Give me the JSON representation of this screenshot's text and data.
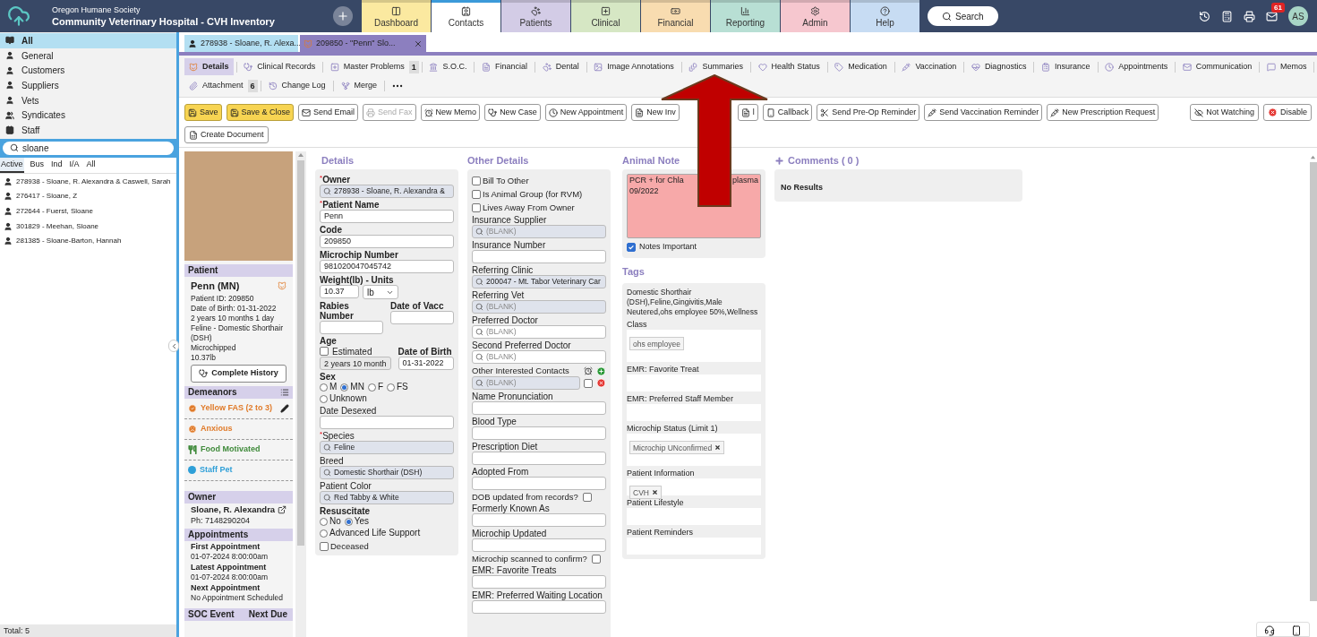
{
  "app": {
    "org": "Oregon Humane Society",
    "title": "Community Veterinary Hospital - CVH Inventory"
  },
  "nav_tabs": [
    {
      "label": "Dashboard",
      "color": "#fbe9a0",
      "selected": false
    },
    {
      "label": "Contacts",
      "color": "#ffffff",
      "selected": true
    },
    {
      "label": "Patients",
      "color": "#d3cce6",
      "selected": false
    },
    {
      "label": "Clinical",
      "color": "#d6e7c4",
      "selected": false
    },
    {
      "label": "Financial",
      "color": "#f8dcb0",
      "selected": false
    },
    {
      "label": "Reporting",
      "color": "#b8dfd4",
      "selected": false
    },
    {
      "label": "Admin",
      "color": "#f6c7cf",
      "selected": false
    },
    {
      "label": "Help",
      "color": "#c7dcf3",
      "selected": false
    }
  ],
  "search_button": "Search",
  "notification_count": "61",
  "avatar": "AS",
  "sidebar": {
    "categories": [
      {
        "label": "All",
        "selected": true
      },
      {
        "label": "General",
        "selected": false
      },
      {
        "label": "Customers",
        "selected": false
      },
      {
        "label": "Suppliers",
        "selected": false
      },
      {
        "label": "Vets",
        "selected": false
      },
      {
        "label": "Syndicates",
        "selected": false
      },
      {
        "label": "Staff",
        "selected": false
      }
    ],
    "search": {
      "value": "sloane"
    },
    "filters": [
      {
        "label": "Active",
        "selected": true
      },
      {
        "label": "Bus",
        "selected": false
      },
      {
        "label": "Ind",
        "selected": false
      },
      {
        "label": "I/A",
        "selected": false
      },
      {
        "label": "All",
        "selected": false
      }
    ],
    "results": [
      "278938 - Sloane, R. Alexandra & Caswell, Sarah",
      "276417 - Sloane, Z",
      "272644 - Fuerst, Sloane",
      "301829 - Meehan, Sloane",
      "281385 - Sloane-Barton, Hannah"
    ],
    "total": "Total: 5"
  },
  "record_tabs": [
    {
      "label": "278938 - Sloane, R. Alexa...",
      "selected": false,
      "closable": false
    },
    {
      "label": "209850 - \"Penn\" Slo...",
      "selected": true,
      "closable": true
    }
  ],
  "subtabs": [
    [
      {
        "label": "Details",
        "selected": true
      },
      {
        "label": "Clinical Records",
        "selected": false
      },
      {
        "label": "Master Problems",
        "selected": false,
        "count": "1"
      },
      {
        "label": "S.O.C.",
        "selected": false
      },
      {
        "label": "Financial",
        "selected": false
      },
      {
        "label": "Dental",
        "selected": false
      },
      {
        "label": "Image Annotations",
        "selected": false
      },
      {
        "label": "Summaries",
        "selected": false
      },
      {
        "label": "Health Status",
        "selected": false
      },
      {
        "label": "Medication",
        "selected": false
      },
      {
        "label": "Vaccination",
        "selected": false
      },
      {
        "label": "Diagnostics",
        "selected": false
      },
      {
        "label": "Insurance",
        "selected": false
      },
      {
        "label": "Appointments",
        "selected": false
      },
      {
        "label": "Communication",
        "selected": false
      },
      {
        "label": "Memos",
        "selected": false
      }
    ],
    [
      {
        "label": "Attachment",
        "selected": false,
        "count": "6"
      },
      {
        "label": "Change Log",
        "selected": false
      },
      {
        "label": "Merge",
        "selected": false
      }
    ]
  ],
  "toolbar": [
    {
      "label": "Save",
      "highlighted": true,
      "disabled": false
    },
    {
      "label": "Save & Close",
      "highlighted": true,
      "disabled": false
    },
    {
      "label": "Send Email",
      "highlighted": false,
      "disabled": false
    },
    {
      "label": "Send Fax",
      "highlighted": false,
      "disabled": true
    },
    {
      "label": "New Memo",
      "highlighted": false,
      "disabled": false
    },
    {
      "label": "New Case",
      "highlighted": false,
      "disabled": false
    },
    {
      "label": "New Appointment",
      "highlighted": false,
      "disabled": false
    },
    {
      "label": "New Inv",
      "highlighted": false,
      "disabled": false
    },
    {
      "label": "l",
      "highlighted": false,
      "disabled": false
    },
    {
      "label": "Callback",
      "highlighted": false,
      "disabled": false
    },
    {
      "label": "Send Pre-Op Reminder",
      "highlighted": false,
      "disabled": false
    },
    {
      "label": "Send Vaccination Reminder",
      "highlighted": false,
      "disabled": false
    },
    {
      "label": "New Prescription Request",
      "highlighted": false,
      "disabled": false
    }
  ],
  "toolbar_right": [
    "Not Watching",
    "Disable"
  ],
  "toolbar_row2": [
    "Create Document"
  ],
  "patient_card": {
    "header": "Patient",
    "name": "Penn (MN)",
    "lines": [
      "Patient ID: 209850",
      "Date of Birth: 01-31-2022",
      "2 years 10 months 1 day",
      "Feline - Domestic Shorthair (DSH)",
      "Microchipped",
      "10.37lb"
    ],
    "history_button": "Complete History",
    "demeanors_header": "Demeanors",
    "demeanors": [
      {
        "label": "Yellow FAS (2 to 3)",
        "color": "#e07b2a",
        "kind": "check"
      },
      {
        "label": "Anxious",
        "color": "#e07b2a",
        "kind": "face"
      },
      {
        "label": "Food Motivated",
        "color": "#3f8a3a",
        "kind": "food"
      },
      {
        "label": "Staff Pet",
        "color": "#2e9fd8",
        "kind": "dot"
      }
    ],
    "owner_header": "Owner",
    "owner_name": "Sloane, R. Alexandra",
    "owner_phone": "Ph: 7148290204",
    "appointments_header": "Appointments",
    "appointments": [
      {
        "label": "First Appointment",
        "value": "01-07-2024 8:00:00am"
      },
      {
        "label": "Latest Appointment",
        "value": "01-07-2024 8:00:00am"
      },
      {
        "label": "Next Appointment",
        "value": "No Appointment Scheduled"
      }
    ],
    "soc_columns": [
      "SOC Event",
      "Next Due"
    ]
  },
  "details": {
    "title": "Details",
    "fields": [
      {
        "kind": "lookup",
        "label": "Owner",
        "required_mark": "*",
        "bold": true,
        "shaded": true,
        "value": "278938 -  Sloane, R. Alexandra &"
      },
      {
        "kind": "text",
        "label": "Patient Name",
        "required_mark": "*",
        "bold": true,
        "value": "Penn"
      },
      {
        "kind": "text",
        "label": "Code",
        "bold": true,
        "value": "209850"
      },
      {
        "kind": "text",
        "label": "Microchip Number",
        "bold": true,
        "value": "981020047045742"
      },
      {
        "kind": "weight",
        "label": "Weight(lb) - Units",
        "value": "10.37",
        "unit": "lb"
      },
      {
        "kind": "pair",
        "labels": [
          "Rabies Number",
          "Date of Vacc"
        ]
      },
      {
        "kind": "age",
        "label": "Age",
        "estimated": false,
        "estimated_label": "Estimated",
        "value": "2 years 10 month",
        "dob_label": "Date of Birth",
        "dob": "01-31-2022"
      },
      {
        "kind": "radio",
        "label": "Sex",
        "bold": true,
        "options": [
          {
            "label": "M",
            "selected": false
          },
          {
            "label": "MN",
            "selected": true
          },
          {
            "label": "F",
            "selected": false
          },
          {
            "label": "FS",
            "selected": false
          },
          {
            "label": "Unknown",
            "selected": false
          }
        ]
      },
      {
        "kind": "text",
        "label": "Date Desexed",
        "bold": false
      },
      {
        "kind": "lookup",
        "label": "Species",
        "required_mark": "*",
        "bold": false,
        "shaded": true,
        "value": "Feline"
      },
      {
        "kind": "lookup",
        "label": "Breed",
        "bold": false,
        "shaded": true,
        "value": "Domestic Shorthair (DSH)"
      },
      {
        "kind": "lookup",
        "label": "Patient Color",
        "bold": false,
        "shaded": true,
        "value": "Red Tabby & White"
      },
      {
        "kind": "radio",
        "label": "Resuscitate",
        "bold": true,
        "options": [
          {
            "label": "No",
            "selected": false
          },
          {
            "label": "Yes",
            "selected": true
          },
          {
            "label": "Advanced Life Support",
            "selected": false
          }
        ]
      },
      {
        "kind": "checkbox",
        "label": "Deceased",
        "checked": false
      }
    ]
  },
  "other_details": {
    "title": "Other Details",
    "fields": [
      {
        "kind": "checkbox",
        "label": "Bill To Other",
        "checked": false
      },
      {
        "kind": "checkbox",
        "label": "Is Animal Group (for RVM)",
        "checked": false
      },
      {
        "kind": "checkbox",
        "label": "Lives Away From Owner",
        "checked": false
      },
      {
        "kind": "lookup",
        "label": "Insurance Supplier",
        "shaded": true,
        "placeholder": "(BLANK)"
      },
      {
        "kind": "text",
        "label": "Insurance Number"
      },
      {
        "kind": "lookup",
        "label": "Referring Clinic",
        "shaded": true,
        "value": "200047 - Mt. Tabor Veterinary Car"
      },
      {
        "kind": "lookup",
        "label": "Referring Vet",
        "shaded": true,
        "placeholder": "(BLANK)"
      },
      {
        "kind": "lookup",
        "label": "Preferred Doctor",
        "shaded": false,
        "placeholder": "(BLANK)"
      },
      {
        "kind": "lookup",
        "label": "Second Preferred Doctor",
        "shaded": false,
        "placeholder": "(BLANK)"
      },
      {
        "kind": "contacts",
        "label": "Other Interested Contacts",
        "placeholder": "(BLANK)",
        "checked": false
      },
      {
        "kind": "text",
        "label": "Name Pronunciation"
      },
      {
        "kind": "text",
        "label": "Blood Type"
      },
      {
        "kind": "text",
        "label": "Prescription Diet"
      },
      {
        "kind": "text",
        "label": "Adopted From"
      },
      {
        "kind": "question",
        "label": "DOB updated from records?",
        "checked": false
      },
      {
        "kind": "text",
        "label": "Formerly Known As"
      },
      {
        "kind": "text",
        "label": "Microchip Updated"
      },
      {
        "kind": "question",
        "label": "Microchip scanned to confirm?",
        "checked": false
      },
      {
        "kind": "text",
        "label": "EMR: Favorite Treats"
      },
      {
        "kind": "text",
        "label": "EMR: Preferred Waiting Location"
      }
    ]
  },
  "animal_notes": {
    "title": "Animal Note",
    "text_left": "PCR + for Chla",
    "text_right": "plasma",
    "text_line2": "09/2022",
    "important": true,
    "important_label": "Notes Important"
  },
  "tags": {
    "title": "Tags",
    "summary": "Domestic Shorthair (DSH),Feline,Gingivitis,Male Neutered,ohs employee 50%,Wellness",
    "groups": [
      {
        "label": "Class",
        "chips": [
          {
            "label": "ohs employee",
            "removable": false
          }
        ]
      },
      {
        "label": "EMR: Favorite Treat"
      },
      {
        "label": "EMR: Preferred Staff Member"
      },
      {
        "label": "Microchip Status (Limit 1)",
        "chips": [
          {
            "label": "Microchip UNconfirmed",
            "removable": true
          }
        ]
      },
      {
        "label": "Patient Information",
        "chips": [
          {
            "label": "CVH",
            "removable": true
          }
        ]
      },
      {
        "label": "Patient Lifestyle"
      },
      {
        "label": "Patient Reminders"
      }
    ]
  },
  "comments": {
    "title": "Comments ( 0 )",
    "empty": "No Results"
  }
}
